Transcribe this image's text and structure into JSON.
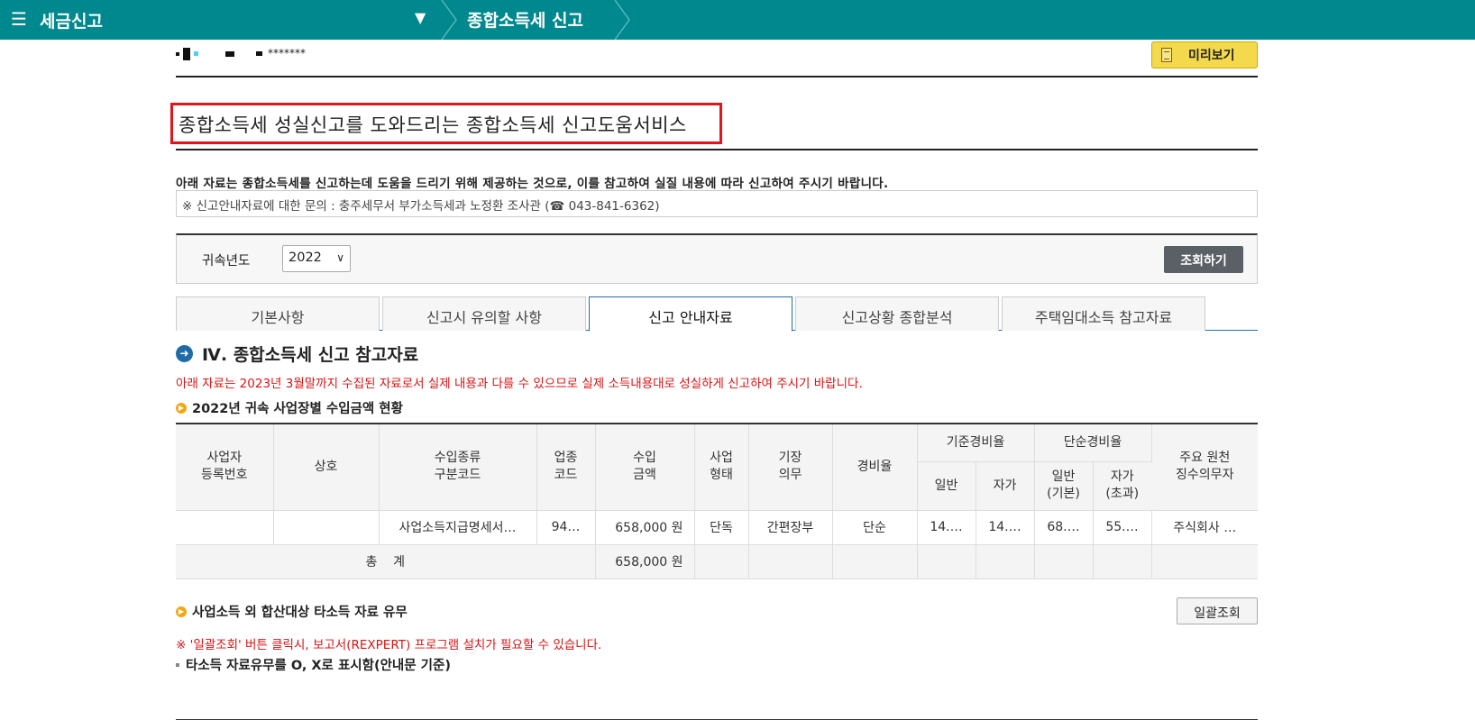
{
  "topbar": {
    "title": "세금신고",
    "breadcrumb": "종합소득세 신고",
    "bg_color": "#00888f"
  },
  "user": {
    "masked": "*******"
  },
  "preview_button": {
    "label": "미리보기",
    "icon": "document-icon"
  },
  "headline": "종합소득세 성실신고를 도와드리는 종합소득세 신고도움서비스",
  "notice": "아래 자료는 종합소득세를 신고하는데 도움을 드리기 위해 제공하는 것으로, 이를 참고하여 실질 내용에 따라 신고하여 주시기 바랍니다.",
  "inquiry": "※ 신고안내자료에 대한 문의 : 충주세무서 부가소득세과 노정환 조사관 (☎ 043-841-6362)",
  "search": {
    "year_label": "귀속년도",
    "year_value": "2022",
    "search_button": "조회하기"
  },
  "tabs": [
    {
      "label": "기본사항",
      "active": false
    },
    {
      "label": "신고시 유의할 사항",
      "active": false
    },
    {
      "label": "신고 안내자료",
      "active": true
    },
    {
      "label": "신고상황 종합분석",
      "active": false
    },
    {
      "label": "주택임대소득 참고자료",
      "active": false
    }
  ],
  "section": {
    "title": "Ⅳ. 종합소득세 신고 참고자료",
    "warning": "아래 자료는 2023년 3월말까지 수집된 자료로서 실제 내용과 다를 수 있으므로 실제 소득내용대로 성실하게 신고하여 주시기 바랍니다.",
    "subtitle": "2022년 귀속 사업장별 수입금액 현황"
  },
  "table": {
    "headers": {
      "biz_no": [
        "사업자",
        "등록번호"
      ],
      "name": "상호",
      "income_type": [
        "수입종류",
        "구분코드"
      ],
      "industry": [
        "업종",
        "코드"
      ],
      "amount": [
        "수입",
        "금액"
      ],
      "biz_type": [
        "사업",
        "형태"
      ],
      "bookkeeping": [
        "기장",
        "의무"
      ],
      "expense_rate": "경비율",
      "std_rate": "기준경비율",
      "simple_rate": "단순경비율",
      "std_general": "일반",
      "std_self": "자가",
      "simple_general": [
        "일반",
        "(기본)"
      ],
      "simple_self": [
        "자가",
        "(초과)"
      ],
      "withholder": [
        "주요 원천",
        "징수의무자"
      ]
    },
    "row": {
      "biz_no": "",
      "name": "",
      "income_type": "사업소득지급명세서…",
      "industry": "94…",
      "amount": "658,000 원",
      "biz_type": "단독",
      "bookkeeping": "간편장부",
      "expense_rate": "단순",
      "std_general": "14.…",
      "std_self": "14.…",
      "simple_general": "68.…",
      "simple_self": "55.…",
      "withholder": "주식회사 …"
    },
    "total": {
      "label": "총    계",
      "amount": "658,000 원"
    }
  },
  "other_income": {
    "subtitle": "사업소득 외 합산대상 타소득 자료 유무",
    "bulk_button": "일괄조회",
    "warning": "※ '일괄조회' 버튼 클릭시, 보고서(REXPERT) 프로그램 설치가 필요할 수 있습니다.",
    "note": "타소득 자료유무를 O, X로 표시함(안내문 기준)"
  }
}
